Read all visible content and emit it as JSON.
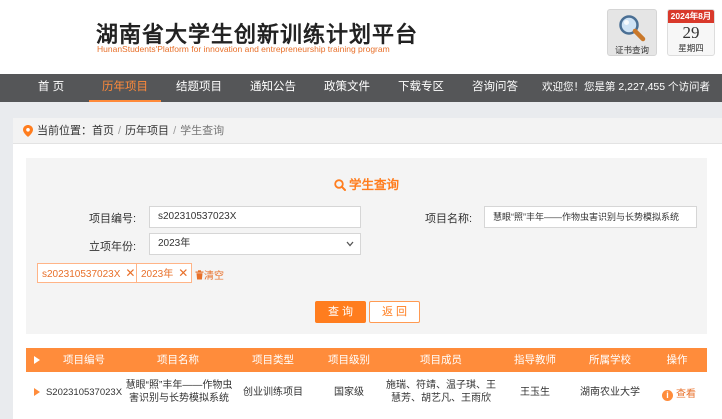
{
  "header": {
    "title": "湖南省大学生创新训练计划平台",
    "subtitle": "HunanStudents'Platform for innovation and entrepreneurship training program",
    "cert_label": "证书查询",
    "calendar": {
      "month": "2024年8月",
      "day": "29",
      "weekday": "星期四"
    }
  },
  "nav": {
    "items": [
      {
        "label": "首 页"
      },
      {
        "label": "历年项目"
      },
      {
        "label": "结题项目"
      },
      {
        "label": "通知公告"
      },
      {
        "label": "政策文件"
      },
      {
        "label": "下载专区"
      },
      {
        "label": "咨询问答"
      }
    ],
    "active_index": 1,
    "visitor_text": "欢迎您！您是第 2,227,455 个访问者"
  },
  "breadcrumb": {
    "prefix": "当前位置：",
    "items": [
      "首页",
      "历年项目",
      "学生查询"
    ]
  },
  "search": {
    "title": "学生查询",
    "project_no_label": "项目编号:",
    "project_no_value": "s202310537023X",
    "project_name_label": "项目名称:",
    "project_name_value": "慧眼“照”丰年——作物虫害识别与长势模拟系统",
    "year_label": "立项年份:",
    "year_value": "2023年",
    "tags": [
      "s202310537023X",
      "2023年"
    ],
    "clear_label": "清空",
    "query_button": "查 询",
    "back_button": "返 回"
  },
  "table": {
    "columns": [
      "项目编号",
      "项目名称",
      "项目类型",
      "项目级别",
      "项目成员",
      "指导教师",
      "所属学校",
      "操作"
    ],
    "rows": [
      {
        "project_no": "S202310537023X",
        "project_name": "慧眼“照”丰年——作物虫害识别与长势模拟系统",
        "project_type": "创业训练项目",
        "project_level": "国家级",
        "members": "施瑞、符靖、温子琪、王慧芳、胡艺凡、王雨欣",
        "advisor": "王玉生",
        "school": "湖南农业大学",
        "action": "查看"
      }
    ]
  },
  "colors": {
    "accent": "#ff7d1e",
    "nav_bg": "#555658",
    "header_accent": "#e8702a"
  },
  "icons": {
    "cert": "magnifier-icon",
    "breadcrumb": "location-pin-icon",
    "search_title": "search-icon",
    "tag_remove": "close-icon",
    "clear": "trash-icon",
    "expand": "caret-right-icon",
    "view": "info-icon"
  }
}
